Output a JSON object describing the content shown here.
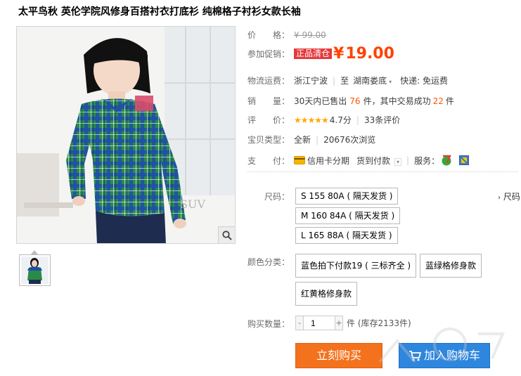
{
  "product": {
    "title": "太平鸟秋 英伦学院风修身百搭衬衣打底衫 纯棉格子衬衫女款长袖"
  },
  "gallery": {
    "watermark_text": "SUV",
    "zoom_icon": "magnifier-icon"
  },
  "price": {
    "label": "价　　格：",
    "original": "¥ 99.00"
  },
  "promo": {
    "label": "参加促销：",
    "tag": "正品清仓",
    "currency": "¥",
    "price": "19.00"
  },
  "shipping": {
    "label": "物流运费：",
    "from": "浙江宁波",
    "to_prefix": "至",
    "to": "湖南娄底",
    "fee": "快递: 免运费"
  },
  "sales": {
    "label": "销　　量：",
    "prefix": "30天内已售出",
    "sold": "76",
    "mid": "件，其中交易成功",
    "success": "22",
    "suffix": "件"
  },
  "rating": {
    "label": "评　　价：",
    "stars": "★★★★★",
    "score": "4.7分",
    "reviews": "33条评价"
  },
  "info": {
    "label": "宝贝类型：",
    "type": "全新",
    "views": "20676次浏览"
  },
  "payment": {
    "label": "支　　付：",
    "credit": "信用卡分期",
    "cod": "货到付款",
    "service_label": "服务："
  },
  "size": {
    "label": "尺码：",
    "chart_link": "尺码",
    "options": [
      "S 155 80A ( 隔天发货 )",
      "M 160 84A ( 隔天发货 )",
      "L 165 88A ( 隔天发货 )"
    ]
  },
  "color": {
    "label": "颜色分类：",
    "options": [
      "蓝色拍下付款19 ( 三标齐全 )",
      "蓝绿格修身款",
      "红黄格修身款"
    ]
  },
  "quantity": {
    "label": "购买数量：",
    "minus": "-",
    "value": "1",
    "plus": "+",
    "stock": "件 (库存2133件)"
  },
  "actions": {
    "buy": "立刻购买",
    "cart": "加入购物车"
  },
  "theme": {
    "price_color": "#ff4200",
    "buy_color": "#f4711d",
    "cart_color": "#2e86de"
  }
}
